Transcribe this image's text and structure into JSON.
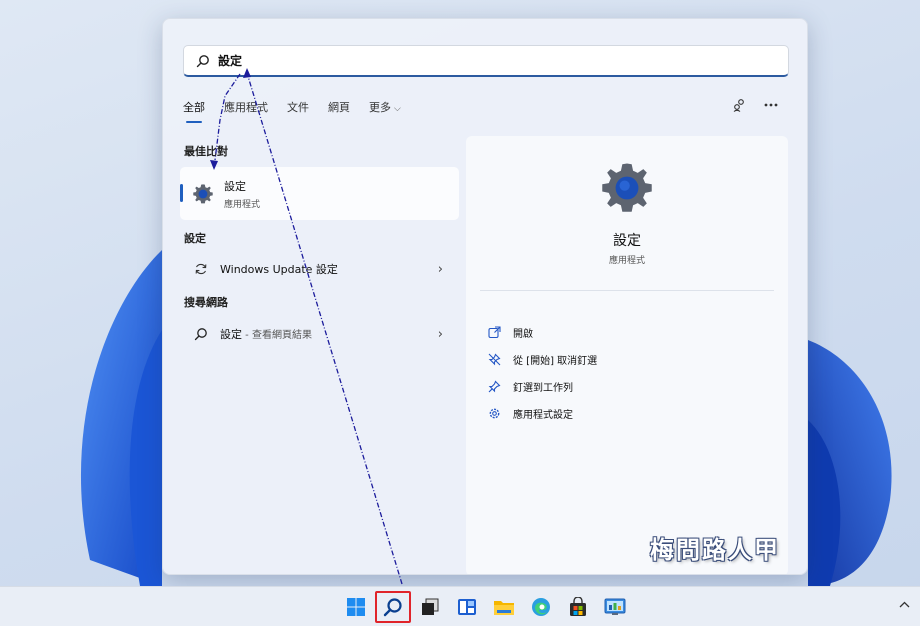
{
  "search": {
    "query": "設定"
  },
  "tabs": [
    {
      "label": "全部"
    },
    {
      "label": "應用程式"
    },
    {
      "label": "文件"
    },
    {
      "label": "網頁"
    },
    {
      "label": "更多"
    }
  ],
  "best_match": {
    "heading": "最佳比對",
    "title": "設定",
    "subtitle": "應用程式"
  },
  "settings_section": {
    "heading": "設定",
    "item": "Windows Update 設定"
  },
  "web_section": {
    "heading": "搜尋網路",
    "item_main": "設定",
    "item_suffix": " - 查看網頁結果"
  },
  "detail": {
    "title": "設定",
    "subtitle": "應用程式",
    "actions": [
      {
        "label": "開啟",
        "icon": "open-external-icon"
      },
      {
        "label": "從 [開始] 取消釘選",
        "icon": "unpin-icon"
      },
      {
        "label": "釘選到工作列",
        "icon": "pin-icon"
      },
      {
        "label": "應用程式設定",
        "icon": "gear-icon"
      }
    ]
  },
  "watermark": "梅問路人甲",
  "colors": {
    "accent": "#1f5fbf",
    "highlight_border": "#e0242a",
    "annotation_line": "#1c1c9c"
  },
  "taskbar": {
    "icons": [
      "start-icon",
      "search-icon",
      "task-view-icon",
      "widgets-icon",
      "file-explorer-icon",
      "edge-icon",
      "store-icon",
      "control-panel-icon"
    ]
  }
}
